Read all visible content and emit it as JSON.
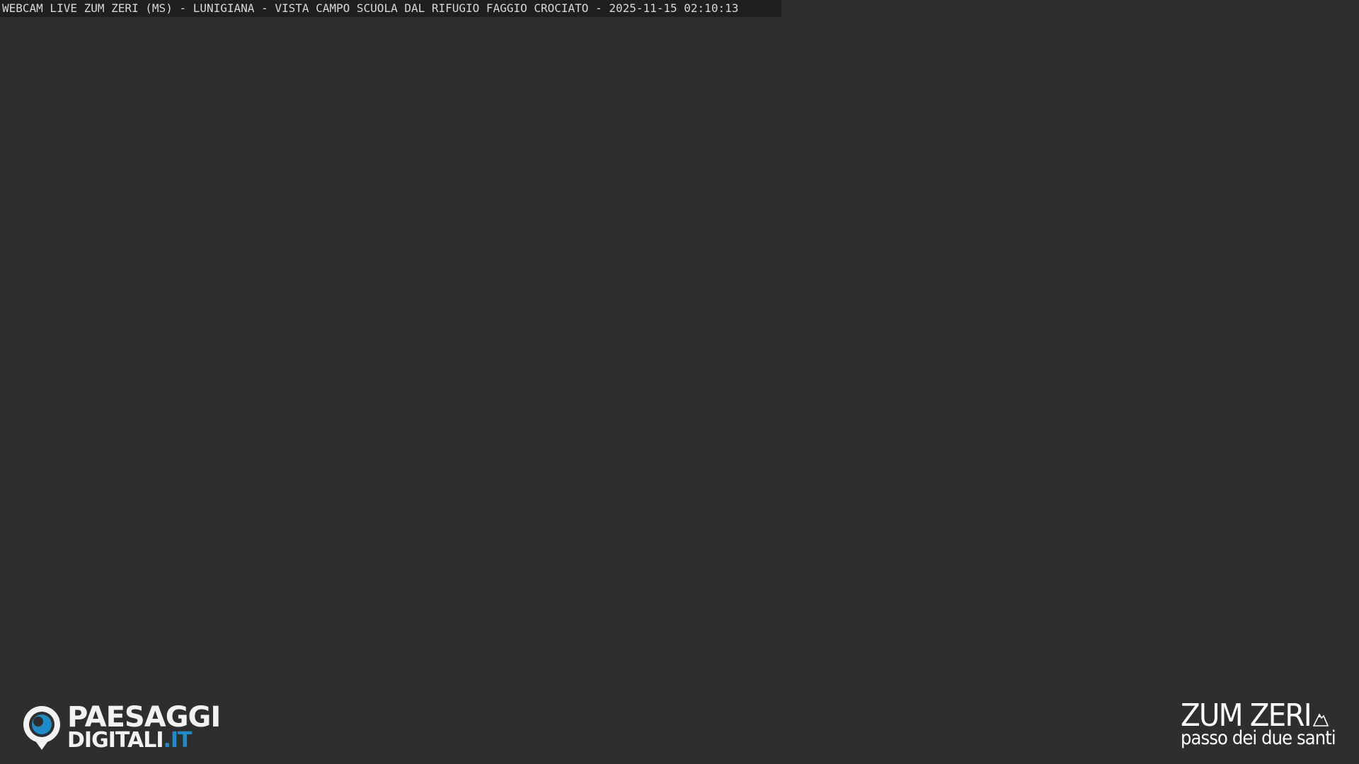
{
  "overlay": {
    "caption": "WEBCAM LIVE ZUM ZERI (MS) - LUNIGIANA - VISTA CAMPO SCUOLA DAL RIFUGIO FAGGIO CROCIATO - 2025-11-15 02:10:13"
  },
  "logo_left": {
    "line1": "PAESAGGI",
    "line2_main": "DIGITALI",
    "line2_tld": ".IT",
    "icon": "eye-pin-icon",
    "accent_color": "#1c8cc8"
  },
  "logo_right": {
    "title": "ZUM ZERI",
    "subtitle": "passo dei due santi",
    "icon": "mountain-peak-icon"
  },
  "colors": {
    "background": "#2e2e2e",
    "caption_bar": "#1f1f1f",
    "text": "#ffffff"
  }
}
